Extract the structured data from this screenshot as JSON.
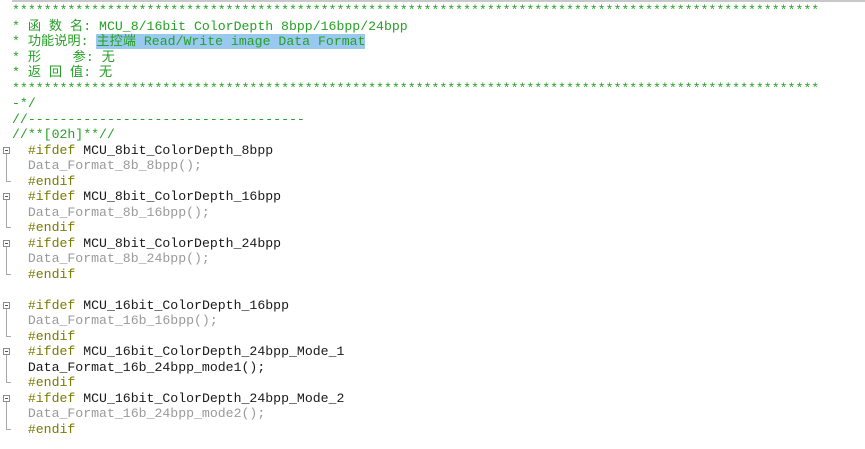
{
  "colors": {
    "comment": "#26a026",
    "keyword": "#7a7a00",
    "macro": "#1a1a1a",
    "disabled": "#9a9a9a",
    "selection": "#99c9ef"
  },
  "lines": [
    {
      "segments": [
        {
          "text": "******************************************************************************************************",
          "color": "comment"
        }
      ]
    },
    {
      "segments": [
        {
          "text": "* 函 数 名: MCU_8/16bit ColorDepth 8bpp/16bpp/24bpp",
          "color": "comment"
        }
      ]
    },
    {
      "segments": [
        {
          "text": "* 功能说明: ",
          "color": "comment"
        },
        {
          "text": "主控端 Read/Write image Data Format",
          "color": "comment",
          "selected": true
        }
      ]
    },
    {
      "segments": [
        {
          "text": "* 形    参: 无",
          "color": "comment"
        }
      ]
    },
    {
      "segments": [
        {
          "text": "* 返 回 值: 无",
          "color": "comment"
        }
      ]
    },
    {
      "segments": [
        {
          "text": "******************************************************************************************************",
          "color": "comment"
        }
      ]
    },
    {
      "segments": [
        {
          "text": "-*/",
          "color": "comment"
        }
      ]
    },
    {
      "segments": [
        {
          "text": "//-----------------------------------",
          "color": "comment"
        }
      ]
    },
    {
      "segments": [
        {
          "text": "//**[02h]**//",
          "color": "comment"
        }
      ]
    },
    {
      "segments": [
        {
          "text": "  #ifdef ",
          "color": "keyword"
        },
        {
          "text": "MCU_8bit_ColorDepth_8bpp",
          "color": "macro"
        }
      ],
      "fold": "open"
    },
    {
      "segments": [
        {
          "text": "  Data_Format_8b_8bpp();",
          "color": "disabled"
        }
      ],
      "fold": "mid"
    },
    {
      "segments": [
        {
          "text": "  #endif",
          "color": "keyword"
        }
      ],
      "fold": "end"
    },
    {
      "segments": [
        {
          "text": "  #ifdef ",
          "color": "keyword"
        },
        {
          "text": "MCU_8bit_ColorDepth_16bpp",
          "color": "macro"
        }
      ],
      "fold": "open"
    },
    {
      "segments": [
        {
          "text": "  Data_Format_8b_16bpp();",
          "color": "disabled"
        }
      ],
      "fold": "mid"
    },
    {
      "segments": [
        {
          "text": "  #endif",
          "color": "keyword"
        }
      ],
      "fold": "end"
    },
    {
      "segments": [
        {
          "text": "  #ifdef ",
          "color": "keyword"
        },
        {
          "text": "MCU_8bit_ColorDepth_24bpp",
          "color": "macro"
        }
      ],
      "fold": "open"
    },
    {
      "segments": [
        {
          "text": "  Data_Format_8b_24bpp();",
          "color": "disabled"
        }
      ],
      "fold": "mid"
    },
    {
      "segments": [
        {
          "text": "  #endif",
          "color": "keyword"
        }
      ],
      "fold": "end"
    },
    {
      "segments": [
        {
          "text": "",
          "color": "macro"
        }
      ]
    },
    {
      "segments": [
        {
          "text": "  #ifdef ",
          "color": "keyword"
        },
        {
          "text": "MCU_16bit_ColorDepth_16bpp",
          "color": "macro"
        }
      ],
      "fold": "open"
    },
    {
      "segments": [
        {
          "text": "  Data_Format_16b_16bpp();",
          "color": "disabled"
        }
      ],
      "fold": "mid"
    },
    {
      "segments": [
        {
          "text": "  #endif",
          "color": "keyword"
        }
      ],
      "fold": "end"
    },
    {
      "segments": [
        {
          "text": "  #ifdef ",
          "color": "keyword"
        },
        {
          "text": "MCU_16bit_ColorDepth_24bpp_Mode_1",
          "color": "macro"
        }
      ],
      "fold": "open"
    },
    {
      "segments": [
        {
          "text": "  Data_Format_16b_24bpp_mode1();",
          "color": "macro"
        }
      ],
      "fold": "mid"
    },
    {
      "segments": [
        {
          "text": "  #endif",
          "color": "keyword"
        }
      ],
      "fold": "end"
    },
    {
      "segments": [
        {
          "text": "  #ifdef ",
          "color": "keyword"
        },
        {
          "text": "MCU_16bit_ColorDepth_24bpp_Mode_2",
          "color": "macro"
        }
      ],
      "fold": "open"
    },
    {
      "segments": [
        {
          "text": "  Data_Format_16b_24bpp_mode2();",
          "color": "disabled"
        }
      ],
      "fold": "mid"
    },
    {
      "segments": [
        {
          "text": "  #endif",
          "color": "keyword"
        }
      ],
      "fold": "end"
    }
  ]
}
